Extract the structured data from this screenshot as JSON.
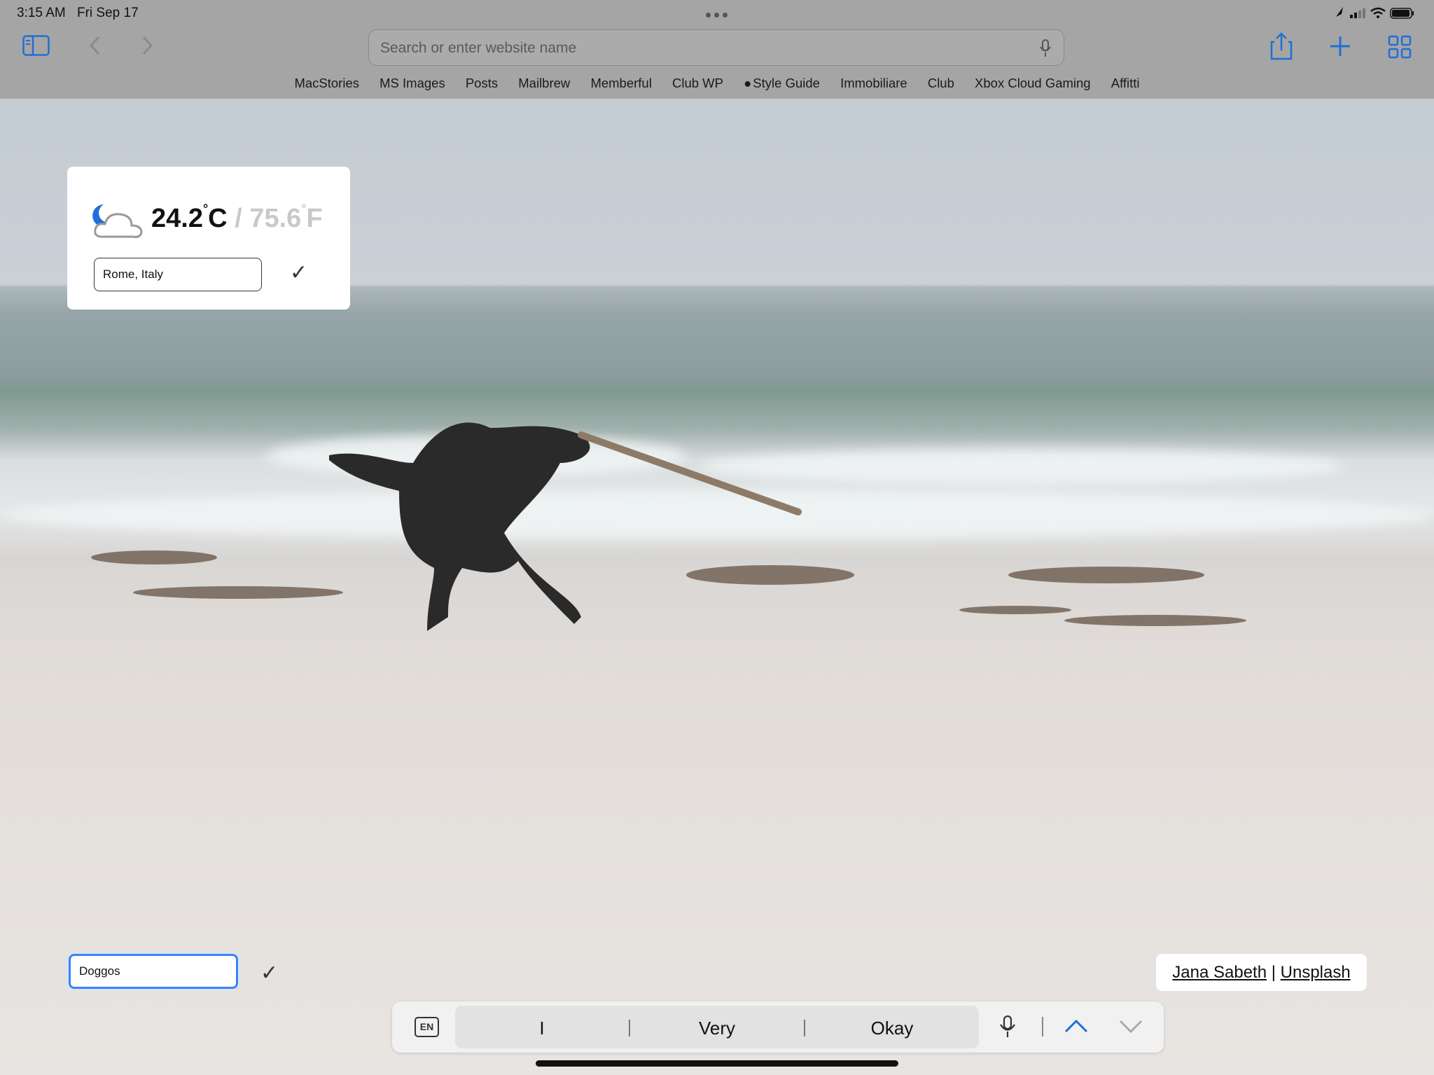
{
  "status_bar": {
    "time": "3:15 AM",
    "date": "Fri Sep 17"
  },
  "toolbar": {
    "search_placeholder": "Search or enter website name",
    "icons": [
      "sidebar-icon",
      "back-icon",
      "forward-icon",
      "microphone-icon",
      "share-icon",
      "plus-icon",
      "tabs-grid-icon"
    ]
  },
  "bookmarks": [
    "MacStories",
    "MS Images",
    "Posts",
    "Mailbrew",
    "Memberful",
    "Club WP",
    "Style Guide",
    "Immobiliare",
    "Club",
    "Xbox Cloud Gaming",
    "Affitti"
  ],
  "weather": {
    "temp_c": "24.2",
    "unit_c": "C",
    "separator": "/",
    "temp_f": "75.6",
    "unit_f": "F",
    "location": "Rome, Italy",
    "icon": "cloud-moon-icon"
  },
  "search_field": {
    "value": "Doggos"
  },
  "credit": {
    "photographer": "Jana Sabeth",
    "separator": "|",
    "source": "Unsplash"
  },
  "keyboard": {
    "language": "EN",
    "suggestions": [
      "I",
      "Very",
      "Okay"
    ]
  },
  "colors": {
    "accent": "#1f6fd6",
    "chrome_bg": "#a5a5a5"
  }
}
